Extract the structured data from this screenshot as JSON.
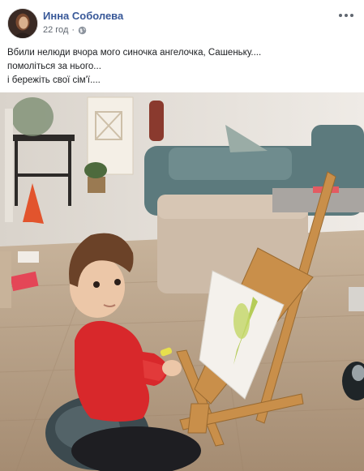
{
  "post": {
    "author": "Инна Соболева",
    "timestamp": "22 год",
    "separator": "·",
    "privacy_icon": "globe-icon",
    "more_icon": "more-options-icon",
    "text_lines": [
      "Вбили нелюди вчора мого синочка ангелочка, Сашеньку....",
      "помоліться за нього...",
      "і бережіть свої сім'ї...."
    ]
  },
  "photo": {
    "subject": "child-painting-at-easel",
    "colors": {
      "floor": "#b9a38a",
      "wall": "#e9e3dc",
      "sofa": "#5c7a7d",
      "ottoman": "#cdbba8",
      "sweater": "#d8282b",
      "easel": "#c98f4a"
    }
  },
  "theme": {
    "link_color": "#385898",
    "meta_color": "#606770",
    "text_color": "#1c1e21"
  }
}
